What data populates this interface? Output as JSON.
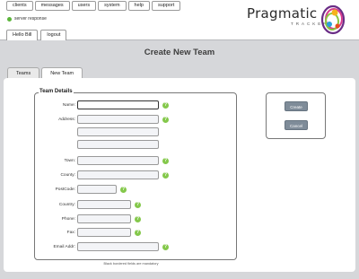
{
  "menu": {
    "items": [
      "clients",
      "messages",
      "users",
      "system",
      "help",
      "support"
    ]
  },
  "status": {
    "text": "server response",
    "color": "#5bb53a"
  },
  "user_tabs": [
    "Hello Bill",
    "logout"
  ],
  "logo": {
    "name": "Pragmatic",
    "sub": "TRACKER"
  },
  "page_title": "Create New Team",
  "tabs": [
    "Teams",
    "New Team"
  ],
  "form": {
    "legend": "Team Details",
    "labels": {
      "name": "Name:",
      "address": "Address:",
      "town": "Town:",
      "county": "County:",
      "postcode": "PostCode:",
      "country": "Country:",
      "phone": "Phone:",
      "fax": "Fax:",
      "email": "Email Addr:"
    },
    "values": {
      "name": "",
      "address1": "",
      "address2": "",
      "address3": "",
      "town": "",
      "county": "",
      "postcode": "",
      "country": "",
      "phone": "",
      "fax": "",
      "email": ""
    },
    "help_glyph": "?",
    "footnote": "Black bordered fields are mandatory"
  },
  "actions": {
    "create": "Create",
    "cancel": "Cancel"
  },
  "colors": {
    "help": "#84c84b",
    "button": "#7f8c99",
    "background": "#d6d7da"
  }
}
